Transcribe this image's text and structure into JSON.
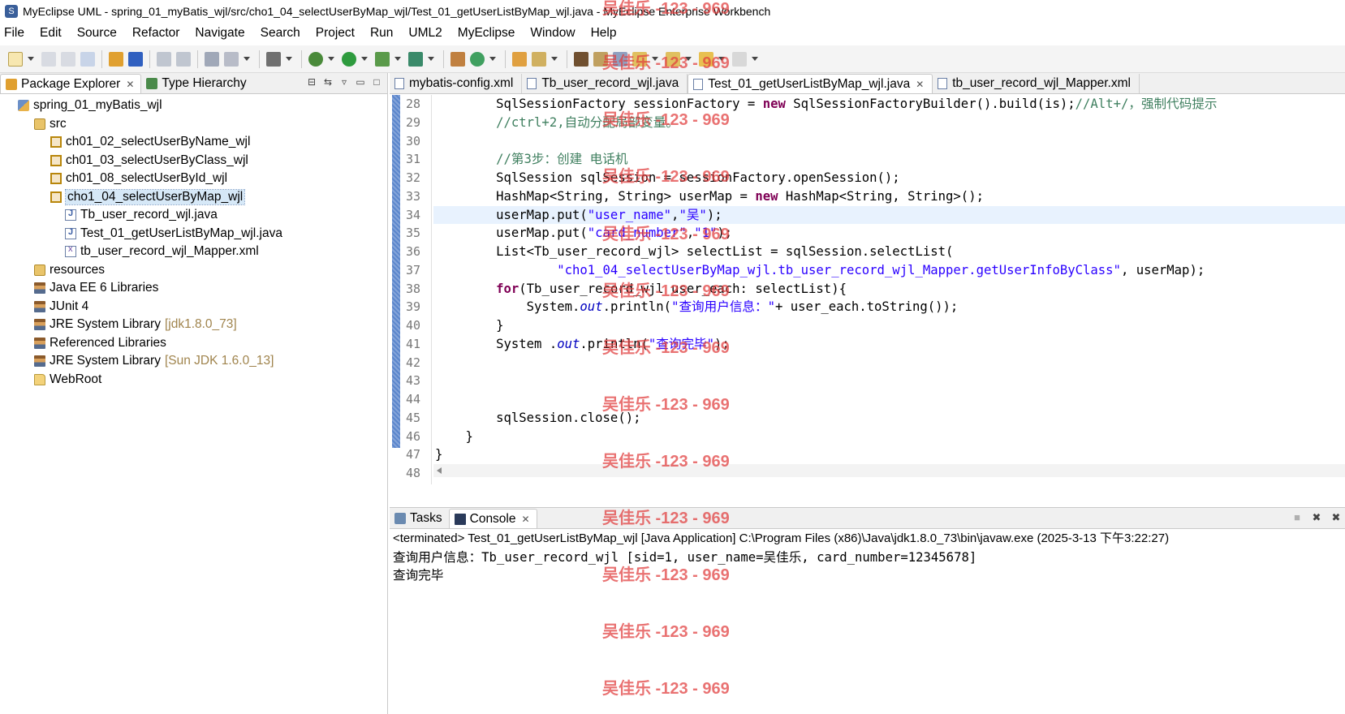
{
  "window": {
    "title": "MyEclipse UML - spring_01_myBatis_wjl/src/cho1_04_selectUserByMap_wjl/Test_01_getUserListByMap_wjl.java - MyEclipse Enterprise Workbench"
  },
  "menubar": {
    "items": [
      "File",
      "Edit",
      "Source",
      "Refactor",
      "Navigate",
      "Search",
      "Project",
      "Run",
      "UML2",
      "MyEclipse",
      "Window",
      "Help"
    ]
  },
  "left_view": {
    "tabs": [
      {
        "label": "Package Explorer",
        "icon": "package-explorer-icon",
        "active": true
      },
      {
        "label": "Type Hierarchy",
        "icon": "type-hierarchy-icon",
        "active": false
      }
    ],
    "tree": [
      {
        "label": "spring_01_myBatis_wjl",
        "icon": "project-icon",
        "indent": 0
      },
      {
        "label": "src",
        "icon": "source-folder-icon",
        "indent": 1
      },
      {
        "label": "ch01_02_selectUserByName_wjl",
        "icon": "package-icon",
        "indent": 2
      },
      {
        "label": "ch01_03_selectUserByClass_wjl",
        "icon": "package-icon",
        "indent": 2
      },
      {
        "label": "ch01_08_selectUserById_wjl",
        "icon": "package-icon",
        "indent": 2
      },
      {
        "label": "cho1_04_selectUserByMap_wjl",
        "icon": "package-icon",
        "indent": 2,
        "selected": true
      },
      {
        "label": "Tb_user_record_wjl.java",
        "icon": "java-file-icon",
        "indent": 3
      },
      {
        "label": "Test_01_getUserListByMap_wjl.java",
        "icon": "java-file-icon",
        "indent": 3
      },
      {
        "label": "tb_user_record_wjl_Mapper.xml",
        "icon": "xml-file-icon",
        "indent": 3
      },
      {
        "label": "resources",
        "icon": "source-folder-icon",
        "indent": 1
      },
      {
        "label": "Java EE 6 Libraries",
        "icon": "library-icon",
        "indent": 1
      },
      {
        "label": "JUnit 4",
        "icon": "library-icon",
        "indent": 1
      },
      {
        "label": "JRE System Library",
        "deco": "[jdk1.8.0_73]",
        "icon": "library-icon",
        "indent": 1
      },
      {
        "label": "Referenced Libraries",
        "icon": "library-icon",
        "indent": 1
      },
      {
        "label": "JRE System Library",
        "deco": "[Sun JDK 1.6.0_13]",
        "icon": "library-icon",
        "indent": 1
      },
      {
        "label": "WebRoot",
        "icon": "folder-icon",
        "indent": 1
      }
    ]
  },
  "editor": {
    "tabs": [
      {
        "label": "mybatis-config.xml",
        "active": false
      },
      {
        "label": "Tb_user_record_wjl.java",
        "active": false
      },
      {
        "label": "Test_01_getUserListByMap_wjl.java",
        "active": true
      },
      {
        "label": "tb_user_record_wjl_Mapper.xml",
        "active": false
      }
    ],
    "current_line": 34,
    "lines": [
      {
        "n": "28",
        "tokens": [
          [
            "",
            "        SqlSessionFactory sessionFactory = "
          ],
          [
            "kw",
            "new"
          ],
          [
            "",
            " SqlSessionFactoryBuilder().build(is);"
          ],
          [
            "cm",
            "//Alt+/，强制代码提示"
          ]
        ]
      },
      {
        "n": "29",
        "tokens": [
          [
            "cm",
            "        //ctrl+2,自动分配局部变量。"
          ]
        ]
      },
      {
        "n": "30",
        "tokens": []
      },
      {
        "n": "31",
        "tokens": [
          [
            "cm",
            "        //第3步：创建 电话机"
          ]
        ]
      },
      {
        "n": "32",
        "tokens": [
          [
            "",
            "        SqlSession sqlSession = sessionFactory.openSession();"
          ]
        ]
      },
      {
        "n": "33",
        "tokens": [
          [
            "",
            "        HashMap<String, String> userMap = "
          ],
          [
            "kw",
            "new"
          ],
          [
            "",
            " HashMap<String, String>();"
          ]
        ]
      },
      {
        "n": "34",
        "tokens": [
          [
            "",
            "        userMap.put("
          ],
          [
            "str",
            "\"user_name\""
          ],
          [
            "",
            ","
          ],
          [
            "str",
            "\"吴\""
          ],
          [
            "",
            ");"
          ]
        ]
      },
      {
        "n": "35",
        "tokens": [
          [
            "",
            "        userMap.put("
          ],
          [
            "str",
            "\"card_number\""
          ],
          [
            "",
            ","
          ],
          [
            "str",
            "\"1\""
          ],
          [
            "",
            ");"
          ]
        ]
      },
      {
        "n": "36",
        "tokens": [
          [
            "",
            "        List<Tb_user_record_wjl> selectList = sqlSession.selectList("
          ]
        ]
      },
      {
        "n": "37",
        "tokens": [
          [
            "",
            "                "
          ],
          [
            "str",
            "\"cho1_04_selectUserByMap_wjl.tb_user_record_wjl_Mapper.getUserInfoByClass\""
          ],
          [
            "",
            ", userMap);"
          ]
        ]
      },
      {
        "n": "38",
        "tokens": [
          [
            "",
            "        "
          ],
          [
            "kw",
            "for"
          ],
          [
            "",
            "(Tb_user_record_wjl user_each: selectList){"
          ]
        ]
      },
      {
        "n": "39",
        "tokens": [
          [
            "",
            "            System."
          ],
          [
            "fld",
            "out"
          ],
          [
            "",
            ".println("
          ],
          [
            "str",
            "\"查询用户信息：\""
          ],
          [
            "",
            "+ user_each.toString());"
          ]
        ]
      },
      {
        "n": "40",
        "tokens": [
          [
            "",
            "        }"
          ]
        ]
      },
      {
        "n": "41",
        "tokens": [
          [
            "",
            "        System ."
          ],
          [
            "fld",
            "out"
          ],
          [
            "",
            ".println("
          ],
          [
            "str",
            "\"查询完毕\""
          ],
          [
            "",
            ");"
          ]
        ]
      },
      {
        "n": "42",
        "tokens": []
      },
      {
        "n": "43",
        "tokens": []
      },
      {
        "n": "44",
        "tokens": []
      },
      {
        "n": "45",
        "tokens": [
          [
            "",
            "        sqlSession.close();"
          ]
        ]
      },
      {
        "n": "46",
        "tokens": [
          [
            "",
            "    }"
          ]
        ]
      },
      {
        "n": "47",
        "tokens": [
          [
            "",
            "}"
          ]
        ]
      },
      {
        "n": "48",
        "tokens": []
      }
    ]
  },
  "console_view": {
    "tabs": [
      {
        "label": "Tasks",
        "active": false
      },
      {
        "label": "Console",
        "active": true
      }
    ],
    "header": "<terminated> Test_01_getUserListByMap_wjl [Java Application] C:\\Program Files (x86)\\Java\\jdk1.8.0_73\\bin\\javaw.exe (2025-3-13 下午3:22:27)",
    "output": [
      "查询用户信息：Tb_user_record_wjl [sid=1, user_name=吴佳乐, card_number=12345678]",
      "查询完毕"
    ]
  },
  "watermark": {
    "text": "吴佳乐 -123 - 969",
    "color": "#e03c3c"
  },
  "colors": {
    "keyword": "#7f0055",
    "string": "#2a00ff",
    "comment": "#3f7f5f",
    "static_field": "#0000c0",
    "current_line": "#e8f2fe",
    "selection": "#d6e8f7",
    "overview_bar": "#5b86cc"
  }
}
